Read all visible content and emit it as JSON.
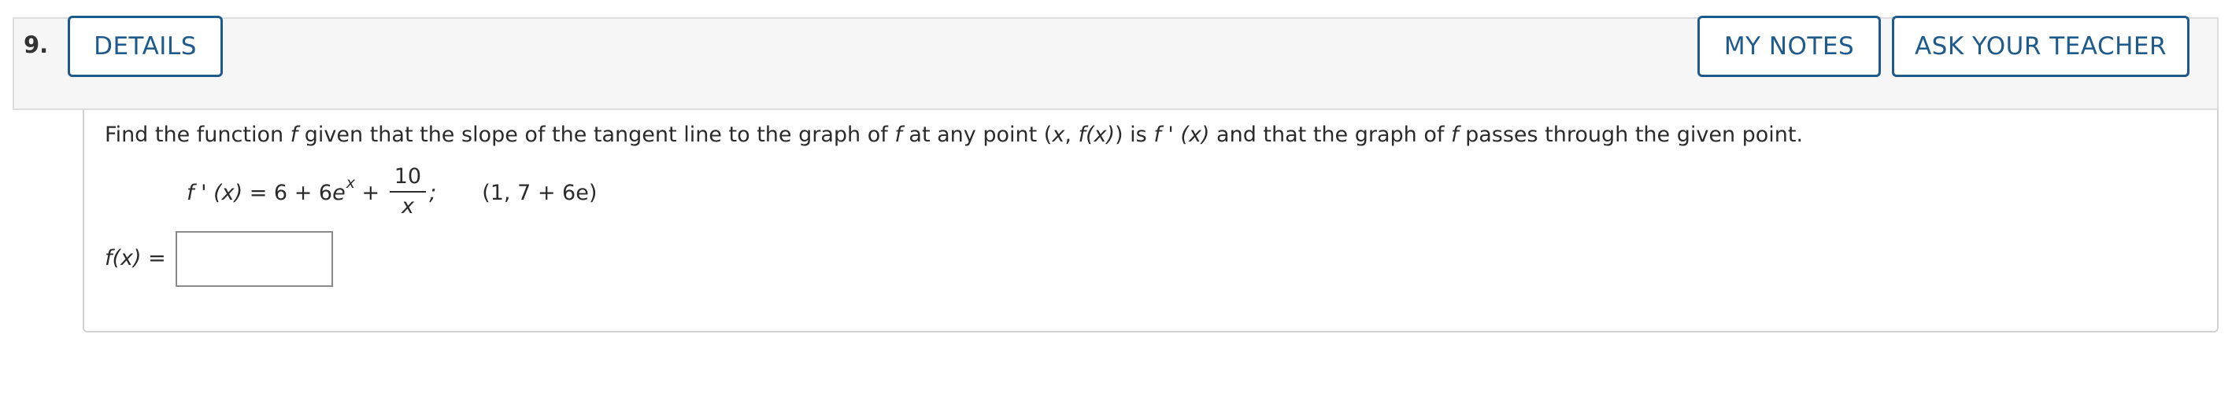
{
  "question": {
    "number": "9.",
    "buttons": {
      "details": "DETAILS",
      "my_notes": "MY NOTES",
      "ask_teacher": "ASK YOUR TEACHER"
    },
    "prompt": {
      "t1": "Find the function ",
      "f1": "f",
      "t2": " given that the slope of the tangent line to the graph of ",
      "f2": "f",
      "t3": " at any point (",
      "x1": "x",
      "t4": ", ",
      "fx": "f(x)",
      "t5": ") is ",
      "fprime": "f ' (x)",
      "t6": " and that the graph of ",
      "f3": "f",
      "t7": " passes through the given point."
    },
    "equation": {
      "lhs": "f ' (x)",
      "eq_text": " = 6 + 6",
      "e": "e",
      "exp": "x",
      "plus": " + ",
      "num": "10",
      "den": "x",
      "semi": ";",
      "point": "(1, 7 + 6e)"
    },
    "answer": {
      "label_f": "f(x)",
      "label_eq": " =",
      "value": ""
    }
  },
  "colors": {
    "accent": "#1f5a8c",
    "header_bg": "#f6f6f6"
  }
}
